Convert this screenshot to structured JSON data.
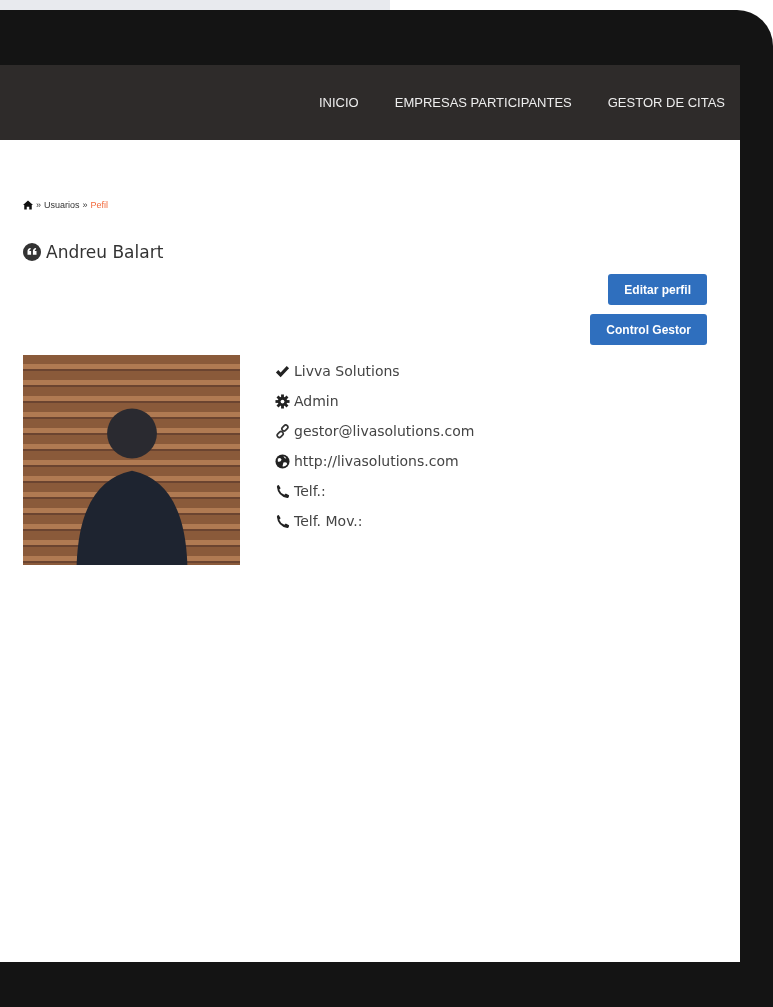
{
  "nav": {
    "items": [
      {
        "label": "INICIO"
      },
      {
        "label": "EMPRESAS PARTICIPANTES"
      },
      {
        "label": "GESTOR DE CITAS"
      }
    ]
  },
  "breadcrumb": [
    {
      "separator": "»",
      "label": "Usuarios",
      "current": false
    },
    {
      "separator": "»",
      "label": "Pefil",
      "current": true
    }
  ],
  "profile": {
    "name": "Andreu Balart",
    "buttons": [
      {
        "label": "Editar perfil"
      },
      {
        "label": "Control Gestor"
      }
    ],
    "info": [
      {
        "kind": "check",
        "text": "Livva Solutions"
      },
      {
        "kind": "gear",
        "text": "Admin"
      },
      {
        "kind": "link",
        "text": "gestor@livasolutions.com"
      },
      {
        "kind": "globe",
        "text": "http://livasolutions.com"
      },
      {
        "kind": "phone",
        "text": "Telf.:"
      },
      {
        "kind": "phone",
        "text": "Telf. Mov.:"
      }
    ]
  }
}
